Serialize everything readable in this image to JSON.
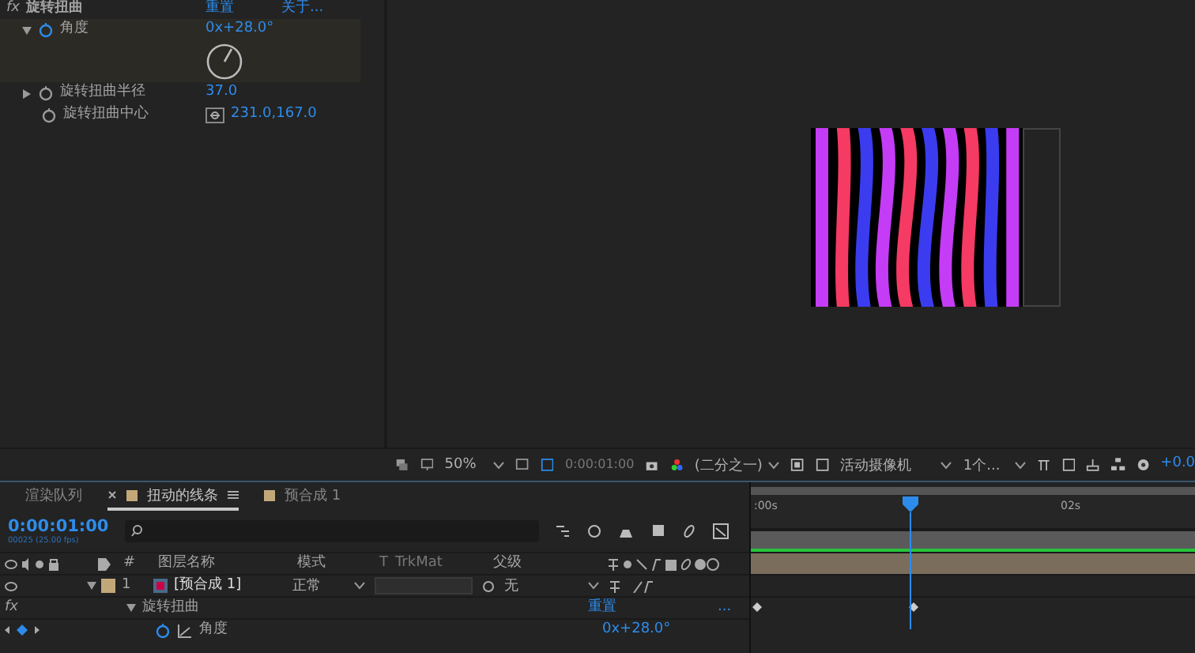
{
  "effect_controls": {
    "effect": {
      "badge": "fx",
      "name": "旋转扭曲",
      "reset": "重置",
      "about": "关于..."
    },
    "properties": [
      {
        "kind": "angle",
        "name": "角度",
        "value": "0x+28.0°",
        "expanded": true
      },
      {
        "kind": "value",
        "name": "旋转扭曲半径",
        "value": "37.0",
        "expanded": false
      },
      {
        "kind": "point",
        "name": "旋转扭曲中心",
        "value": "231.0,167.0"
      }
    ]
  },
  "viewer_toolbar": {
    "zoom": "50%",
    "timecode": "0:00:01:00",
    "resolution": "(二分之一)",
    "camera": "活动摄像机",
    "views": "1个...",
    "exposure": "+0.0"
  },
  "timeline": {
    "tabs": [
      {
        "label": "渲染队列",
        "selected": false,
        "closable": false
      },
      {
        "label": "扭动的线条",
        "selected": true,
        "closable": true
      },
      {
        "label": "预合成 1",
        "selected": false,
        "closable": false
      }
    ],
    "timecode": "0:00:01:00",
    "frame_info": "00025 (25.00 fps)",
    "columns": [
      "#",
      "图层名称",
      "模式",
      "T",
      "TrkMat",
      "父级"
    ],
    "layers": [
      {
        "number": "1",
        "name": "[预合成 1]",
        "mode": "正常",
        "parent": "无",
        "expanded": true,
        "effects": [
          {
            "badge": "fx",
            "name": "旋转扭曲",
            "reset": "重置",
            "more": "...",
            "properties": [
              {
                "name": "角度",
                "value": "0x+28.0°"
              }
            ]
          }
        ]
      }
    ],
    "ruler": [
      ":00s",
      "02s"
    ],
    "playhead": {
      "level": 0.36
    }
  }
}
